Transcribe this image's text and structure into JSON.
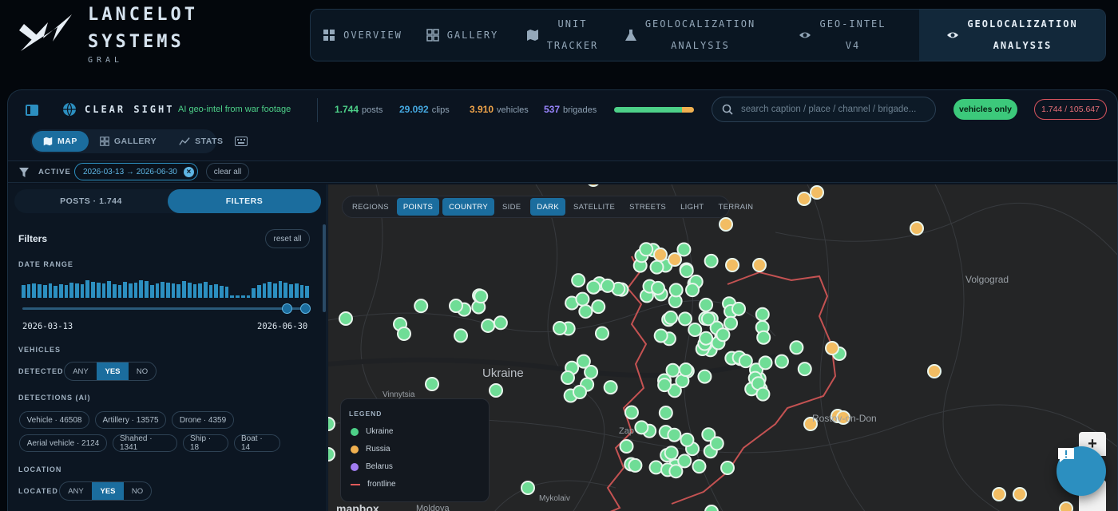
{
  "brand": {
    "line1": "LANCELOT",
    "line2": "SYSTEMS",
    "line3": "GRAL"
  },
  "nav": [
    {
      "label": "OVERVIEW",
      "icon": "grid-icon"
    },
    {
      "label": "GALLERY",
      "icon": "grid-icon"
    },
    {
      "label": "UNIT\nTRACKER",
      "icon": "map-icon"
    },
    {
      "label": "GEOLOCALIZATION\nANALYSIS",
      "icon": "flask-icon"
    },
    {
      "label": "GEO-INTEL\nV4",
      "icon": "eye-icon"
    },
    {
      "label": "GEOLOCALIZATION\nANALYSIS",
      "icon": "eye-icon",
      "active": true
    }
  ],
  "toolbar": {
    "title": "CLEAR SIGHT",
    "subtitle": "AI geo-intel from war footage",
    "stats": [
      {
        "value": "1.744",
        "label": "posts",
        "color": "#4dd088"
      },
      {
        "value": "29.092",
        "label": "clips",
        "color": "#45a8e0"
      },
      {
        "value": "3.910",
        "label": "vehicles",
        "color": "#f0a44a"
      },
      {
        "value": "537",
        "label": "brigades",
        "color": "#9a86ff"
      }
    ],
    "progress_fraction": 0.85,
    "search_placeholder": "search caption / place / channel / brigade...",
    "vehicles_only": "vehicles only",
    "count": "1.744 / 105.647",
    "tabs": [
      "MAP",
      "GALLERY",
      "STATS"
    ]
  },
  "filterbar": {
    "active_label": "ACTIVE",
    "chip": "2026-03-13 → 2026-06-30",
    "clear": "clear all"
  },
  "sidebar": {
    "tabs": [
      "POSTS · 1.744",
      "FILTERS"
    ],
    "title": "Filters",
    "reset": "reset all",
    "date_range_label": "DATE RANGE",
    "date_from": "2026-03-13",
    "date_to": "2026-06-30",
    "vehicles_label": "VEHICLES",
    "detected_label": "DETECTED",
    "options": [
      "ANY",
      "YES",
      "NO"
    ],
    "detections_label": "DETECTIONS (AI)",
    "detections": [
      "Vehicle · 46508",
      "Artillery · 13575",
      "Drone · 4359",
      "Aerial vehicle · 2124",
      "Shahed · 1341",
      "Ship · 18",
      "Boat · 14"
    ],
    "location_label": "LOCATION",
    "located_label": "LOCATED"
  },
  "map": {
    "controls": [
      "REGIONS",
      "POINTS",
      "COUNTRY",
      "SIDE",
      "DARK",
      "SATELLITE",
      "STREETS",
      "LIGHT",
      "TERRAIN"
    ],
    "labels": {
      "ukraine": "Ukraine",
      "volgograd": "Volgograd",
      "rostov": "Rostov-on-Don",
      "vinnytsia": "Vinnytsia",
      "mykolaiv": "Mykolaiv",
      "moldova": "Moldova",
      "zap": "Zap"
    },
    "legend": {
      "title": "LEGEND",
      "items": [
        {
          "label": "Ukraine",
          "color": "#4dd088"
        },
        {
          "label": "Russia",
          "color": "#f0b050"
        },
        {
          "label": "Belarus",
          "color": "#a07cf0"
        },
        {
          "label": "frontline",
          "color": "#e05a5a"
        }
      ]
    },
    "attribution": "mapbox"
  },
  "colors": {
    "ukraine": "#6fdd96",
    "russia": "#f2bd63",
    "accent": "#1b6d9e"
  }
}
